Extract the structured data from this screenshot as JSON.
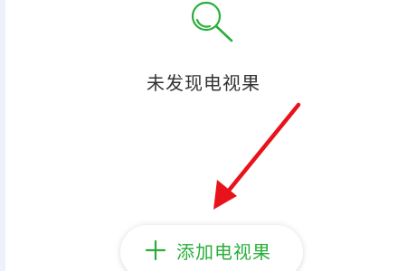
{
  "empty_state": {
    "icon": "search-icon",
    "message": "未发现电视果"
  },
  "add_button": {
    "icon": "plus-icon",
    "label": "添加电视果"
  },
  "annotation": {
    "icon": "red-arrow-icon"
  },
  "colors": {
    "accent_green": "#2aae3a",
    "text_dark": "#333333",
    "arrow_red": "#e8131a",
    "background": "#ffffff"
  }
}
